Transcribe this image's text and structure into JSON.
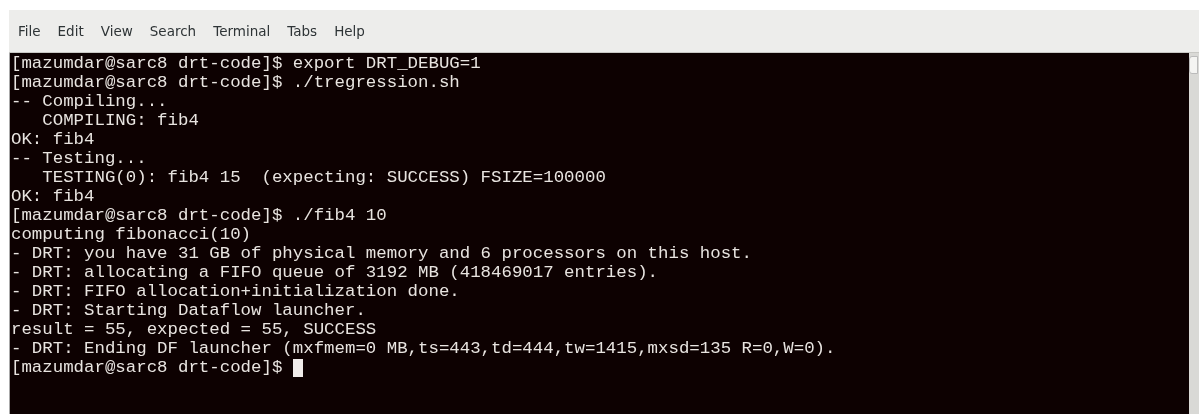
{
  "menu_bar": [
    {
      "label": "File"
    },
    {
      "label": "Edit"
    },
    {
      "label": "View"
    },
    {
      "label": "Search"
    },
    {
      "label": "Terminal"
    },
    {
      "label": "Tabs"
    },
    {
      "label": "Help"
    }
  ],
  "terminal": {
    "lines": [
      "[mazumdar@sarc8 drt-code]$ export DRT_DEBUG=1",
      "[mazumdar@sarc8 drt-code]$ ./tregression.sh",
      "-- Compiling...",
      "   COMPILING: fib4",
      "OK: fib4",
      "-- Testing...",
      "   TESTING(0): fib4 15  (expecting: SUCCESS) FSIZE=100000",
      "OK: fib4",
      "[mazumdar@sarc8 drt-code]$ ./fib4 10",
      "computing fibonacci(10)",
      "- DRT: you have 31 GB of physical memory and 6 processors on this host.",
      "- DRT: allocating a FIFO queue of 3192 MB (418469017 entries).",
      "- DRT: FIFO allocation+initialization done.",
      "- DRT: Starting Dataflow launcher.",
      "result = 55, expected = 55, SUCCESS",
      "- DRT: Ending DF launcher (mxfmem=0 MB,ts=443,td=444,tw=1415,mxsd=135 R=0,W=0).",
      "[mazumdar@sarc8 drt-code]$ "
    ],
    "cursor_visible": true
  }
}
